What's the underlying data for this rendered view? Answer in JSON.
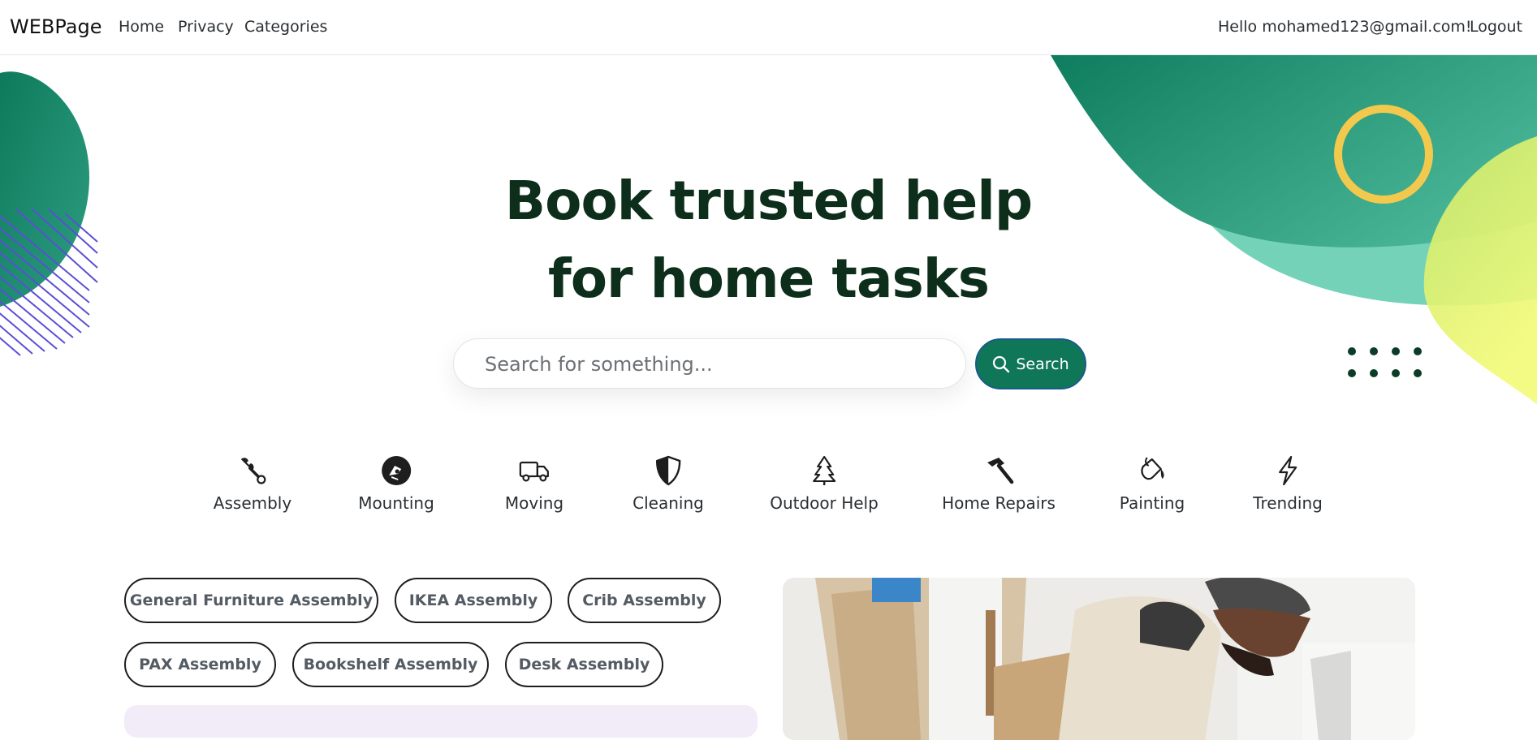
{
  "navbar": {
    "brand": "WEBPage",
    "links": [
      "Home",
      "Privacy",
      "Categories"
    ],
    "greeting": "Hello mohamed123@gmail.com!",
    "logout": "Logout"
  },
  "hero": {
    "title_line1": "Book trusted help",
    "title_line2": "for home tasks",
    "search_placeholder": "Search for something...",
    "search_button": "Search"
  },
  "categories": [
    {
      "label": "Assembly",
      "icon": "wrench-icon"
    },
    {
      "label": "Mounting",
      "icon": "mounting-icon"
    },
    {
      "label": "Moving",
      "icon": "truck-icon"
    },
    {
      "label": "Cleaning",
      "icon": "shield-icon"
    },
    {
      "label": "Outdoor Help",
      "icon": "tree-icon"
    },
    {
      "label": "Home Repairs",
      "icon": "hammer-icon"
    },
    {
      "label": "Painting",
      "icon": "paint-bucket-icon"
    },
    {
      "label": "Trending",
      "icon": "lightning-icon"
    }
  ],
  "chips": [
    "General Furniture Assembly",
    "IKEA Assembly",
    "Crib Assembly",
    "PAX Assembly",
    "Bookshelf Assembly",
    "Desk Assembly"
  ],
  "colors": {
    "brand_green": "#0f7658",
    "title_dark": "#0e2e1c",
    "accent_yellow": "#f2c94c",
    "accent_lime": "#e6f56a",
    "stripe_purple": "#5a4fd6"
  }
}
